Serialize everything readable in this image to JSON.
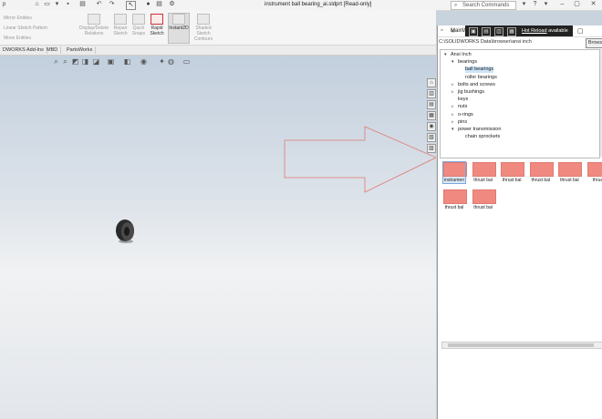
{
  "window": {
    "title": "instrument ball bearing_ai.sldprt [Read-only]",
    "app_menu": "p",
    "search_placeholder": "Search Commands"
  },
  "ribbon": {
    "mirror_entities": "Mirror Entities",
    "linear_sketch_pattern": "Linear Sketch Pattern",
    "move_entities": "Move Entities",
    "display_delete_relations": "Display/Delete Relations",
    "repair_sketch": "Repair Sketch",
    "quick_snaps": "Quick Snaps",
    "rapid_sketch": "Rapid Sketch",
    "instant2d": "Instant2D",
    "shaded_sketch_contours": "Shaded Sketch Contours"
  },
  "tabs": [
    "DWORKS Add-Ins",
    "MBD",
    "PartsWorks"
  ],
  "overlay": {
    "hot_reload": "Hot Reload",
    "available": "available"
  },
  "panel": {
    "title": "MainWi",
    "path": "C:\\SOLIDWORKS Data\\browser\\ansi inch",
    "browse_label": "Browse"
  },
  "tree": [
    {
      "label": "Ansi Inch",
      "level": 0,
      "expander": "▾"
    },
    {
      "label": "bearings",
      "level": 1,
      "expander": "▾"
    },
    {
      "label": "ball bearings",
      "level": 2,
      "expander": "",
      "selected": true
    },
    {
      "label": "roller bearings",
      "level": 2,
      "expander": ""
    },
    {
      "label": "bolts and screws",
      "level": 1,
      "expander": "▹"
    },
    {
      "label": "jig bushings",
      "level": 1,
      "expander": "▹"
    },
    {
      "label": "keys",
      "level": 1,
      "expander": ""
    },
    {
      "label": "nuts",
      "level": 1,
      "expander": "▹"
    },
    {
      "label": "o-rings",
      "level": 1,
      "expander": "▹"
    },
    {
      "label": "pins",
      "level": 1,
      "expander": "▹"
    },
    {
      "label": "power transmission",
      "level": 1,
      "expander": "▾"
    },
    {
      "label": "chain sprockets",
      "level": 2,
      "expander": ""
    }
  ],
  "thumbnails": [
    {
      "label": "instrumen",
      "selected": true
    },
    {
      "label": "thrust bal",
      "selected": false
    },
    {
      "label": "thrust bal",
      "selected": false
    },
    {
      "label": "thrust bal",
      "selected": false
    },
    {
      "label": "thrust bal",
      "selected": false
    },
    {
      "label": "thrust",
      "selected": false
    },
    {
      "label": "thrust bal",
      "selected": false
    },
    {
      "label": "thrust bal",
      "selected": false
    }
  ],
  "colors": {
    "thumb_fill": "#f08a80",
    "arrow_outline": "#e07a70",
    "overlay_bg": "#222222"
  }
}
